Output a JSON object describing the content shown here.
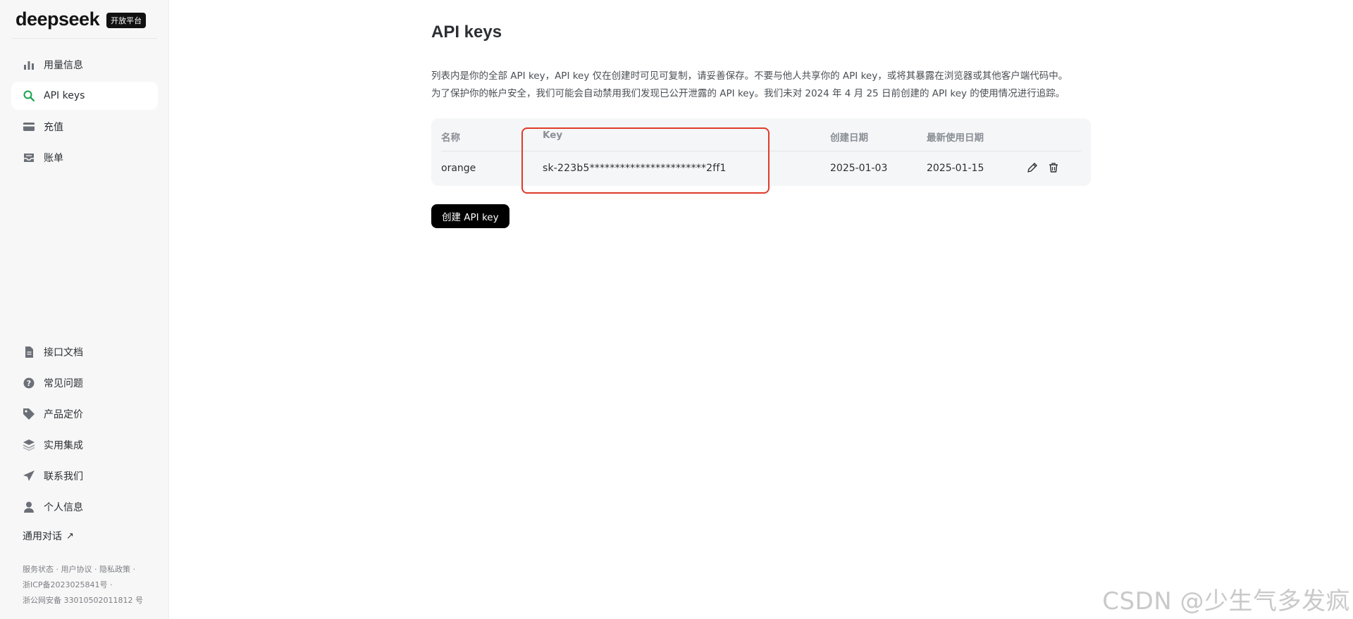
{
  "brand": {
    "logo": "deepseek",
    "badge": "开放平台"
  },
  "sidebar": {
    "items": [
      {
        "label": "用量信息",
        "icon": "bar-chart-icon",
        "active": false
      },
      {
        "label": "API keys",
        "icon": "search-icon",
        "active": true
      },
      {
        "label": "充值",
        "icon": "credit-card-icon",
        "active": false
      },
      {
        "label": "账单",
        "icon": "inbox-icon",
        "active": false
      }
    ],
    "bottom_items": [
      {
        "label": "接口文档",
        "icon": "document-icon"
      },
      {
        "label": "常见问题",
        "icon": "question-icon"
      },
      {
        "label": "产品定价",
        "icon": "tag-icon"
      },
      {
        "label": "实用集成",
        "icon": "layers-icon"
      },
      {
        "label": "联系我们",
        "icon": "send-icon"
      },
      {
        "label": "个人信息",
        "icon": "user-icon"
      }
    ],
    "external_link": {
      "label": "通用对话",
      "icon": "arrow-up-right-icon"
    },
    "footer": {
      "service_status": "服务状态",
      "user_agreement": "用户协议",
      "privacy_policy": "隐私政策",
      "icp": "浙ICP备2023025841号",
      "police": "浙公网安备 33010502011812 号"
    }
  },
  "main": {
    "title": "API keys",
    "description_line1": "列表内是你的全部 API key，API key 仅在创建时可见可复制，请妥善保存。不要与他人共享你的 API key，或将其暴露在浏览器或其他客户端代码中。",
    "description_line2": "为了保护你的帐户安全，我们可能会自动禁用我们发现已公开泄露的 API key。我们未对 2024 年 4 月 25 日前创建的 API key 的使用情况进行追踪。",
    "table": {
      "headers": {
        "name": "名称",
        "key": "Key",
        "created": "创建日期",
        "last_used": "最新使用日期"
      },
      "rows": [
        {
          "name": "orange",
          "key": "sk-223b5***********************2ff1",
          "created": "2025-01-03",
          "last_used": "2025-01-15"
        }
      ]
    },
    "create_button": "创建 API key"
  },
  "watermark": "CSDN @少生气多发疯",
  "colors": {
    "highlight": "#e03a2a",
    "active_icon": "#16a34a",
    "button_bg": "#000000"
  }
}
